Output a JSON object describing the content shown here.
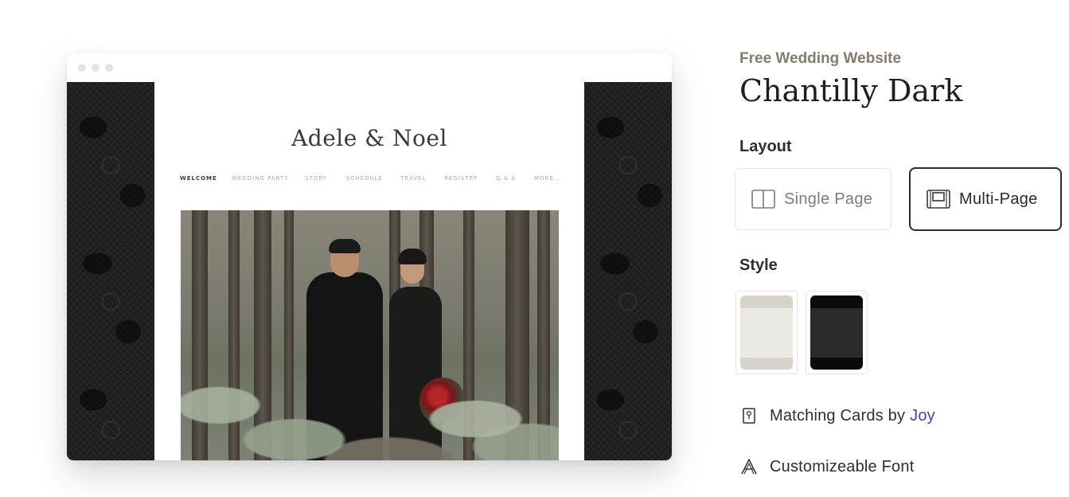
{
  "preview": {
    "couple_name": "Adele & Noel",
    "nav_items": [
      "WELCOME",
      "WEDDING PARTY",
      "STORY",
      "SCHEDULE",
      "TRAVEL",
      "REGISTRY",
      "Q & A",
      "MORE..."
    ],
    "active_nav": "WELCOME"
  },
  "details": {
    "eyebrow": "Free Wedding Website",
    "title": "Chantilly Dark",
    "layout_label": "Layout",
    "layout_options": [
      {
        "label": "Single Page",
        "selected": false,
        "icon": "single-page-icon"
      },
      {
        "label": "Multi-Page",
        "selected": true,
        "icon": "multi-page-icon"
      }
    ],
    "style_label": "Style",
    "style_options": [
      {
        "name": "light",
        "accent": "#ece9e4",
        "border": "#d7d2ca"
      },
      {
        "name": "dark",
        "accent": "#2a2b2d",
        "border": "#0b0b0b"
      }
    ],
    "features": [
      {
        "icon": "card-icon",
        "text": "Matching Cards by",
        "link": "Joy"
      },
      {
        "icon": "font-icon",
        "text": "Customizeable Font"
      }
    ]
  },
  "colors": {
    "eyebrow": "#857b6e",
    "link": "#5b3a9a",
    "lace_bg": "#1d1e20"
  }
}
